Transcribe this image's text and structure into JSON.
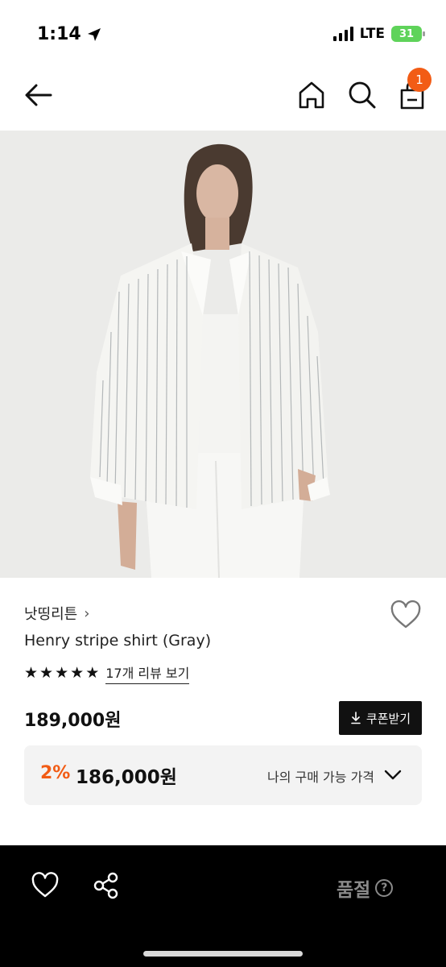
{
  "status_bar": {
    "time": "1:14",
    "network": "LTE",
    "battery": "31"
  },
  "nav": {
    "cart_count": "1"
  },
  "product": {
    "brand": "낫띵리튼",
    "name": "Henry stripe shirt (Gray)",
    "rating_stars": 5,
    "review_link": "17개 리뷰 보기",
    "price": "189,000원",
    "coupon_button": "쿠폰받기",
    "discount_rate": "2%",
    "discount_price": "186,000원",
    "benefit_label": "나의 구매 가능 가격"
  },
  "bottom_bar": {
    "status": "품절",
    "help": "?"
  },
  "colors": {
    "accent": "#f25c15",
    "bar": "#000000",
    "muted": "#8a8a8a"
  },
  "icons": [
    "back-arrow-icon",
    "home-icon",
    "search-icon",
    "shopping-bag-icon",
    "heart-icon",
    "star-icon",
    "download-icon",
    "chevron-down-icon",
    "share-icon",
    "help-icon"
  ]
}
